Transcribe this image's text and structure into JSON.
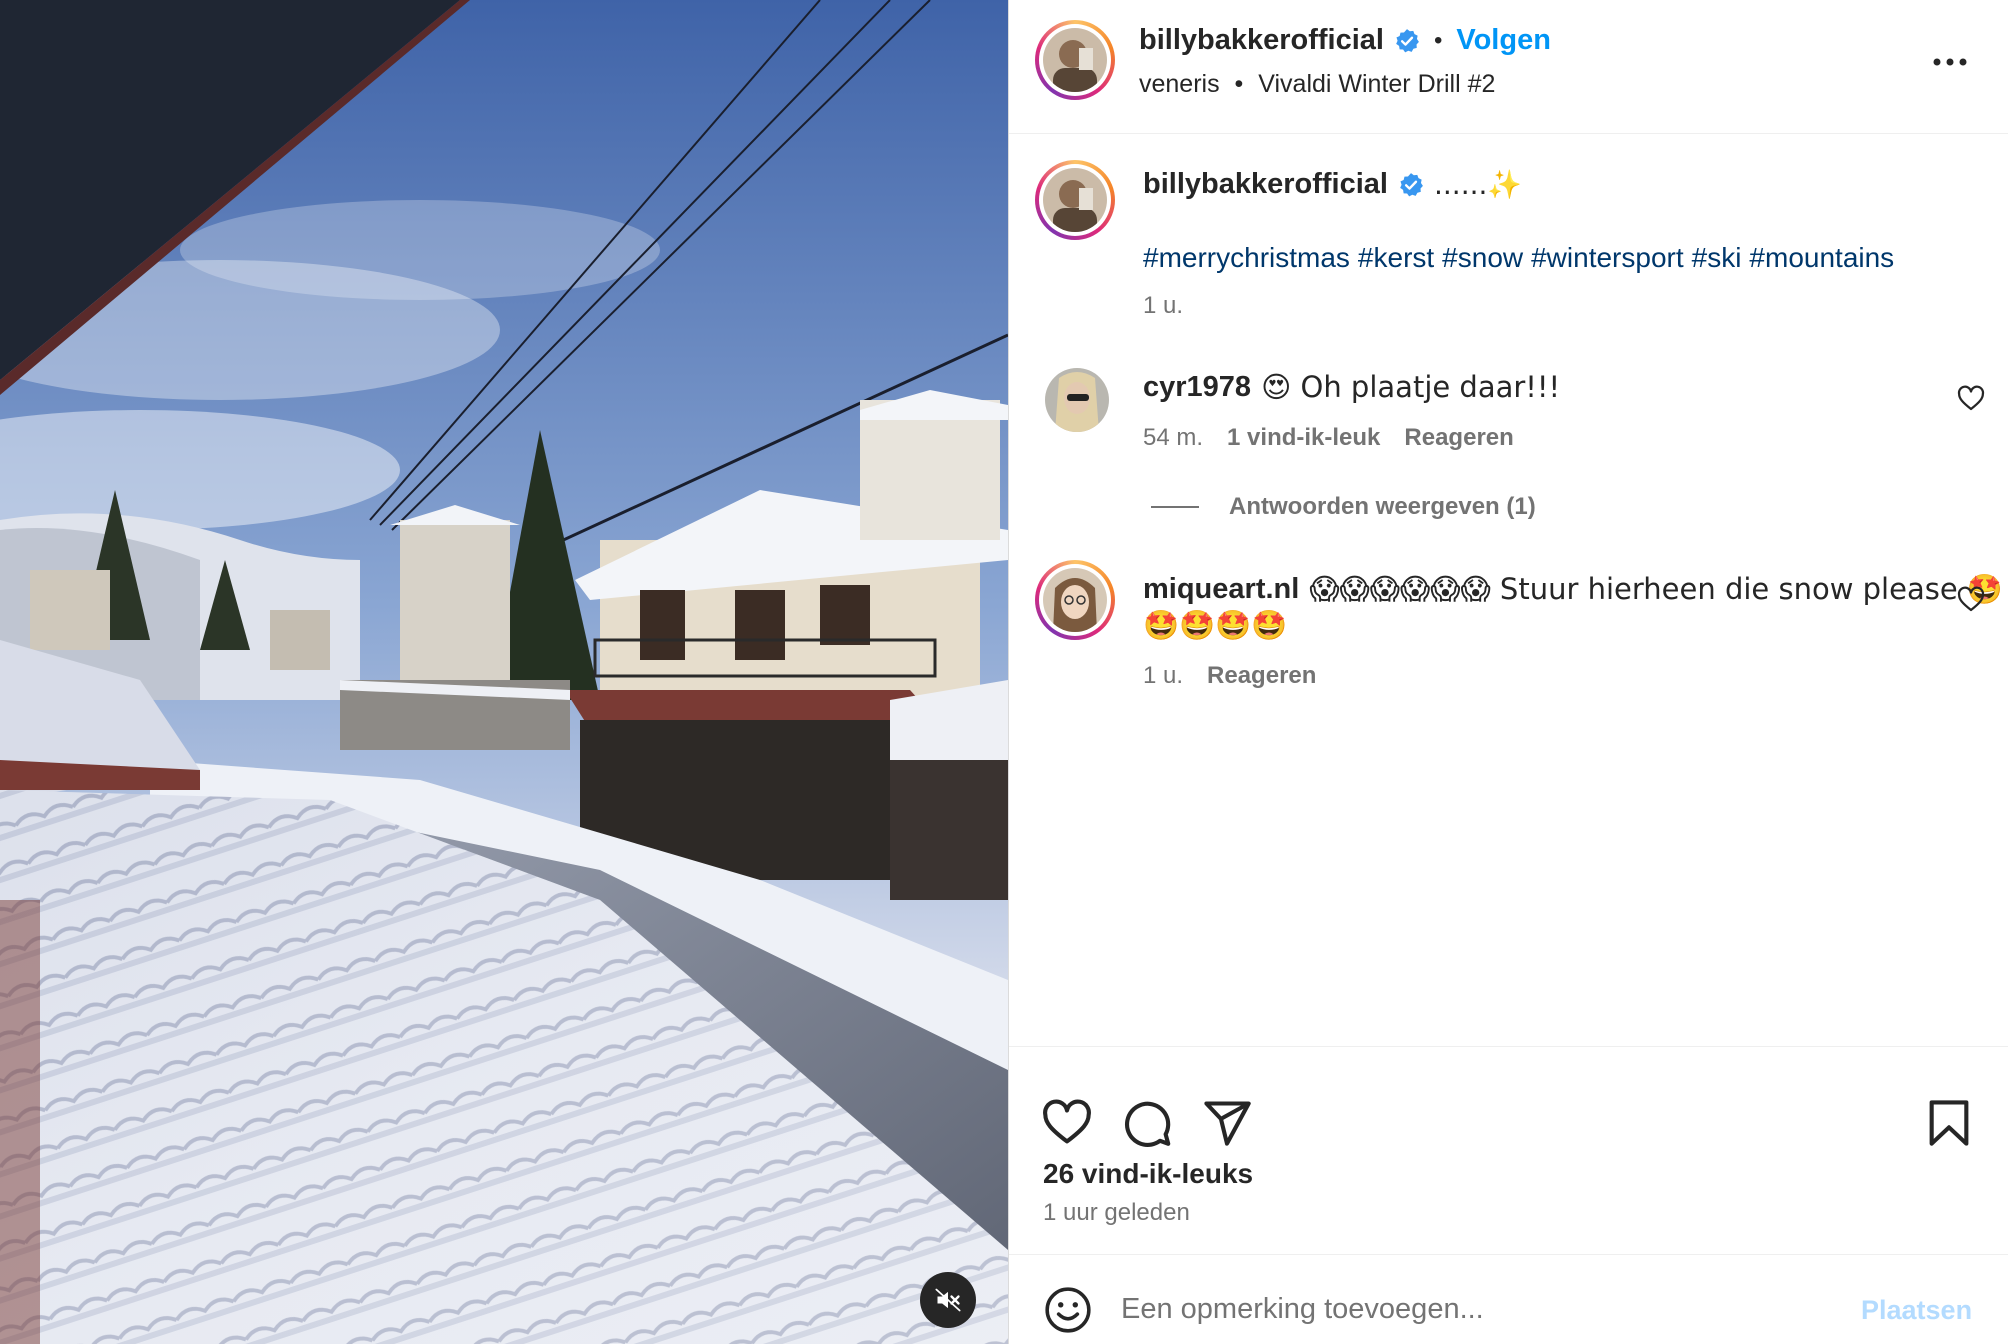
{
  "post": {
    "media": {
      "type": "video",
      "description_icon": "mute-icon"
    },
    "header": {
      "username": "billybakkerofficial",
      "follow_label": "Volgen",
      "location": "veneris",
      "audio": "Vivaldi Winter Drill #2",
      "separator": "•"
    },
    "caption": {
      "username": "billybakkerofficial",
      "text": "......✨",
      "hashtags": [
        "#merrychristmas",
        "#kerst",
        "#snow",
        "#wintersport",
        "#ski",
        "#mountains"
      ],
      "time": "1 u."
    },
    "comments": [
      {
        "username": "cyr1978",
        "text": "😍 Oh plaatje daar!!!",
        "time": "54 m.",
        "likes_label": "1 vind-ik-leuk",
        "reply_label": "Reageren",
        "view_replies_label": "Antwoorden weergeven (1)"
      },
      {
        "username": "miqueart.nl",
        "text": "😱😱😱😱😱😱 Stuur hierheen die snow please 🤩",
        "text_line2": "🤩🤩🤩🤩",
        "time": "1 u.",
        "reply_label": "Reageren"
      }
    ],
    "likes": "26 vind-ik-leuks",
    "posted_ago": "1 uur geleden",
    "comment_box": {
      "placeholder": "Een opmerking toevoegen...",
      "post_label": "Plaatsen"
    }
  },
  "colors": {
    "link": "#0095f6",
    "hashtag": "#00376b",
    "secondary": "#737373",
    "verified": "#3897f0",
    "post_disabled": "#b3dbff"
  },
  "icons": [
    "verified-badge-icon",
    "more-options-icon",
    "heart-icon",
    "comment-icon",
    "share-icon",
    "bookmark-icon",
    "emoji-icon",
    "mute-icon"
  ]
}
